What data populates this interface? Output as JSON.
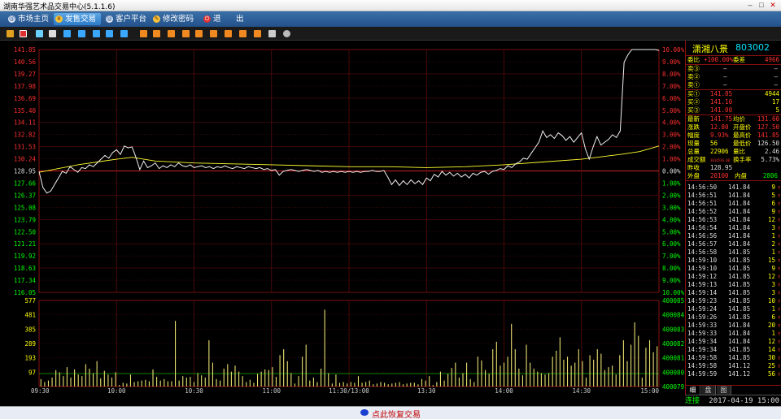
{
  "window": {
    "title": "湖南华强艺术品交易中心(5.1.1.6)",
    "min": "–",
    "max": "□",
    "close": "✕"
  },
  "menu": [
    {
      "label": "市场主页",
      "icon": "globe-icon",
      "active": false
    },
    {
      "label": "发售交易",
      "icon": "yen-icon",
      "active": true
    },
    {
      "label": "客户平台",
      "icon": "globe-icon",
      "active": false
    },
    {
      "label": "修改密码",
      "icon": "pencil-icon",
      "active": false
    },
    {
      "label": "退",
      "icon": "power-icon",
      "active": false
    },
    {
      "label": "出",
      "icon": "",
      "active": false
    }
  ],
  "stock": {
    "name": "潇湘八景",
    "code": "803002"
  },
  "quote": {
    "weibi_label": "委比",
    "weibi": "+100.00%",
    "weicha_label": "委差",
    "weicha": "4966",
    "asks": [
      {
        "label": "卖③",
        "price": "—",
        "vol": "—"
      },
      {
        "label": "卖②",
        "price": "—",
        "vol": "—"
      },
      {
        "label": "卖①",
        "price": "—",
        "vol": "—"
      }
    ],
    "bids": [
      {
        "label": "买①",
        "price": "141.85",
        "vol": "4944"
      },
      {
        "label": "买②",
        "price": "141.10",
        "vol": "17"
      },
      {
        "label": "买③",
        "price": "141.00",
        "vol": "5"
      }
    ],
    "stats": [
      {
        "l1": "最新",
        "v1": "141.75",
        "l2": "均价",
        "v2": "131.60"
      },
      {
        "l1": "涨跌",
        "v1": "12.80",
        "l2": "开盘价",
        "v2": "127.50"
      },
      {
        "l1": "幅度",
        "v1": "9.93%",
        "l2": "最高价",
        "v2": "141.85"
      },
      {
        "l1": "现量",
        "v1": "56",
        "l2": "最低价",
        "v2": "126.50"
      },
      {
        "l1": "总量",
        "v1": "22906",
        "l2": "量比",
        "v2": "2.46"
      },
      {
        "l1": "成交额",
        "v1": "3014536.00",
        "l2": "换手率",
        "v2": "5.73%"
      }
    ],
    "prev_label": "昨收",
    "prev": "128.95",
    "outer_label": "外盘",
    "outer": "20100",
    "inner_label": "内盘",
    "inner": "2806"
  },
  "trades": [
    {
      "time": "14:56:50",
      "price": "141.84",
      "vol": "9"
    },
    {
      "time": "14:56:51",
      "price": "141.84",
      "vol": "5"
    },
    {
      "time": "14:56:51",
      "price": "141.84",
      "vol": "6"
    },
    {
      "time": "14:56:52",
      "price": "141.84",
      "vol": "9"
    },
    {
      "time": "14:56:53",
      "price": "141.84",
      "vol": "12"
    },
    {
      "time": "14:56:54",
      "price": "141.84",
      "vol": "3"
    },
    {
      "time": "14:56:56",
      "price": "141.84",
      "vol": "1"
    },
    {
      "time": "14:56:57",
      "price": "141.84",
      "vol": "2"
    },
    {
      "time": "14:56:58",
      "price": "141.85",
      "vol": "1"
    },
    {
      "time": "14:59:10",
      "price": "141.85",
      "vol": "15"
    },
    {
      "time": "14:59:10",
      "price": "141.85",
      "vol": "9"
    },
    {
      "time": "14:59:12",
      "price": "141.85",
      "vol": "12"
    },
    {
      "time": "14:59:13",
      "price": "141.85",
      "vol": "3"
    },
    {
      "time": "14:59:14",
      "price": "141.85",
      "vol": "3"
    },
    {
      "time": "14:59:23",
      "price": "141.85",
      "vol": "10"
    },
    {
      "time": "14:59:24",
      "price": "141.85",
      "vol": "1"
    },
    {
      "time": "14:59:26",
      "price": "141.85",
      "vol": "6"
    },
    {
      "time": "14:59:33",
      "price": "141.84",
      "vol": "20"
    },
    {
      "time": "14:59:33",
      "price": "141.84",
      "vol": "1"
    },
    {
      "time": "14:59:34",
      "price": "141.84",
      "vol": "12"
    },
    {
      "time": "14:59:34",
      "price": "141.85",
      "vol": "14"
    },
    {
      "time": "14:59:58",
      "price": "141.85",
      "vol": "30"
    },
    {
      "time": "14:59:58",
      "price": "141.12",
      "vol": "25"
    },
    {
      "time": "14:59:59",
      "price": "141.12",
      "vol": "56"
    }
  ],
  "tabs": [
    "细",
    "盘",
    "图"
  ],
  "status": {
    "conn": "连接",
    "datetime": "2017-04-19 15:00"
  },
  "bottom": {
    "resume": "点此恢复交易"
  },
  "chart_data": {
    "type": "line",
    "price_axis": [
      "141.85",
      "140.56",
      "139.27",
      "137.98",
      "136.69",
      "135.40",
      "134.11",
      "132.82",
      "131.53",
      "130.24",
      "128.95",
      "127.66",
      "126.37",
      "125.08",
      "123.79",
      "122.50",
      "121.21",
      "119.92",
      "118.63",
      "117.34",
      "116.05"
    ],
    "pct_axis": [
      "10.00%",
      "9.00%",
      "8.00%",
      "7.00%",
      "6.00%",
      "5.00%",
      "4.00%",
      "3.00%",
      "2.00%",
      "1.00%",
      "0.00%",
      "1.00%",
      "2.00%",
      "3.00%",
      "4.00%",
      "5.00%",
      "6.00%",
      "7.00%",
      "8.00%",
      "9.00%",
      "10.00%"
    ],
    "vol_axis": [
      "577",
      "481",
      "385",
      "289",
      "193",
      "97"
    ],
    "vol_axis_right": [
      "400085",
      "400084",
      "400083",
      "400082",
      "400081",
      "400080",
      "400079"
    ],
    "time_labels": [
      "09:30",
      "10:00",
      "10:30",
      "11:00",
      "11:30/13:00",
      "13:30",
      "14:00",
      "14:30",
      "15:00"
    ],
    "prev_close": 128.95,
    "price_min": 116.05,
    "price_max": 141.85,
    "vol_max": 577,
    "price_series": [
      [
        0,
        128.9
      ],
      [
        1,
        127.2
      ],
      [
        2,
        126.6
      ],
      [
        3,
        126.8
      ],
      [
        4,
        127.5
      ],
      [
        5,
        128.2
      ],
      [
        6,
        128.9
      ],
      [
        7,
        128.7
      ],
      [
        8,
        129.4
      ],
      [
        9,
        129.1
      ],
      [
        10,
        128.8
      ],
      [
        11,
        129.3
      ],
      [
        12,
        129.2
      ],
      [
        13,
        129.6
      ],
      [
        14,
        129.4
      ],
      [
        15,
        129.8
      ],
      [
        16,
        130.2
      ],
      [
        17,
        130.6
      ],
      [
        18,
        130.3
      ],
      [
        19,
        130.9
      ],
      [
        20,
        131.2
      ],
      [
        21,
        130.7
      ],
      [
        22,
        131.6
      ],
      [
        23,
        131.4
      ],
      [
        24,
        131.5
      ],
      [
        25,
        130.4
      ],
      [
        26,
        129.1
      ],
      [
        27,
        130.0
      ],
      [
        28,
        129.3
      ],
      [
        29,
        129.5
      ],
      [
        30,
        129.8
      ],
      [
        31,
        129.2
      ],
      [
        32,
        129.5
      ],
      [
        33,
        129.3
      ],
      [
        34,
        129.6
      ],
      [
        35,
        129.4
      ],
      [
        36,
        129.8
      ],
      [
        37,
        129.5
      ],
      [
        38,
        129.4
      ],
      [
        39,
        129.6
      ],
      [
        40,
        129.3
      ],
      [
        41,
        129.4
      ],
      [
        42,
        129.5
      ],
      [
        43,
        129.3
      ],
      [
        44,
        129.4
      ],
      [
        45,
        129.2
      ],
      [
        46,
        129.4
      ],
      [
        47,
        129.3
      ],
      [
        48,
        129.5
      ],
      [
        49,
        129.3
      ],
      [
        50,
        129.2
      ],
      [
        51,
        129.4
      ],
      [
        52,
        129.3
      ],
      [
        53,
        129.2
      ],
      [
        54,
        129.4
      ],
      [
        55,
        129.3
      ],
      [
        56,
        129.2
      ],
      [
        57,
        129.3
      ],
      [
        58,
        129.1
      ],
      [
        59,
        129.2
      ],
      [
        60,
        129.0
      ],
      [
        61,
        129.1
      ],
      [
        62,
        128.5
      ],
      [
        63,
        128.9
      ],
      [
        64,
        129.0
      ],
      [
        65,
        129.1
      ],
      [
        66,
        129.0
      ],
      [
        67,
        128.9
      ],
      [
        68,
        129.0
      ],
      [
        69,
        129.1
      ],
      [
        70,
        129.0
      ],
      [
        71,
        128.9
      ],
      [
        72,
        129.0
      ],
      [
        73,
        128.8
      ],
      [
        74,
        128.9
      ],
      [
        75,
        128.8
      ],
      [
        76,
        128.9
      ],
      [
        77,
        128.8
      ],
      [
        78,
        128.9
      ],
      [
        79,
        128.8
      ],
      [
        80,
        128.9
      ],
      [
        81,
        128.8
      ],
      [
        82,
        128.9
      ],
      [
        83,
        128.8
      ],
      [
        84,
        128.9
      ],
      [
        85,
        128.9
      ],
      [
        86,
        129.0
      ],
      [
        87,
        128.9
      ],
      [
        88,
        128.9
      ],
      [
        89,
        129.0
      ],
      [
        90,
        128.3
      ],
      [
        91,
        127.5
      ],
      [
        92,
        128.0
      ],
      [
        93,
        127.4
      ],
      [
        94,
        127.9
      ],
      [
        95,
        127.5
      ],
      [
        96,
        128.0
      ],
      [
        97,
        127.6
      ],
      [
        98,
        127.9
      ],
      [
        99,
        127.5
      ],
      [
        100,
        128.2
      ],
      [
        101,
        127.9
      ],
      [
        102,
        128.6
      ],
      [
        103,
        128.3
      ],
      [
        104,
        128.9
      ],
      [
        105,
        128.5
      ],
      [
        106,
        128.8
      ],
      [
        107,
        128.4
      ],
      [
        108,
        128.7
      ],
      [
        109,
        128.3
      ],
      [
        110,
        128.6
      ],
      [
        111,
        128.2
      ],
      [
        112,
        128.7
      ],
      [
        113,
        128.5
      ],
      [
        114,
        128.8
      ],
      [
        115,
        128.9
      ],
      [
        116,
        128.6
      ],
      [
        117,
        128.9
      ],
      [
        118,
        129.0
      ],
      [
        119,
        129.2
      ],
      [
        120,
        129.1
      ],
      [
        121,
        129.5
      ],
      [
        122,
        129.3
      ],
      [
        123,
        129.7
      ],
      [
        124,
        129.9
      ],
      [
        125,
        130.3
      ],
      [
        126,
        130.2
      ],
      [
        127,
        130.8
      ],
      [
        128,
        131.4
      ],
      [
        129,
        132.0
      ],
      [
        130,
        133.2
      ],
      [
        131,
        132.5
      ],
      [
        132,
        132.8
      ],
      [
        133,
        132.4
      ],
      [
        134,
        133.0
      ],
      [
        135,
        132.7
      ],
      [
        136,
        132.2
      ],
      [
        137,
        132.6
      ],
      [
        138,
        132.0
      ],
      [
        139,
        132.5
      ],
      [
        140,
        133.0
      ],
      [
        141,
        131.3
      ],
      [
        142,
        130.2
      ],
      [
        143,
        131.5
      ],
      [
        144,
        132.6
      ],
      [
        145,
        131.7
      ],
      [
        146,
        132.0
      ],
      [
        147,
        132.3
      ],
      [
        148,
        132.8
      ],
      [
        149,
        132.5
      ],
      [
        150,
        133.2
      ],
      [
        151,
        140.5
      ],
      [
        152,
        141.3
      ],
      [
        153,
        141.85
      ],
      [
        154,
        141.85
      ],
      [
        155,
        141.85
      ],
      [
        156,
        141.85
      ],
      [
        157,
        141.85
      ],
      [
        158,
        141.85
      ],
      [
        159,
        141.85
      ],
      [
        160,
        141.75
      ]
    ],
    "avg_series": [
      [
        0,
        128.8
      ],
      [
        10,
        129.6
      ],
      [
        20,
        130.2
      ],
      [
        24,
        130.4
      ],
      [
        30,
        130.0
      ],
      [
        40,
        129.8
      ],
      [
        50,
        129.7
      ],
      [
        60,
        129.6
      ],
      [
        70,
        129.5
      ],
      [
        80,
        129.4
      ],
      [
        90,
        129.4
      ],
      [
        100,
        129.3
      ],
      [
        110,
        129.4
      ],
      [
        120,
        129.6
      ],
      [
        130,
        129.9
      ],
      [
        140,
        130.2
      ],
      [
        150,
        130.7
      ],
      [
        155,
        131.0
      ],
      [
        160,
        131.6
      ]
    ],
    "volumes": [
      50,
      30,
      40,
      60,
      110,
      95,
      70,
      130,
      60,
      115,
      80,
      70,
      150,
      120,
      90,
      170,
      55,
      105,
      80,
      60,
      95,
      10,
      25,
      20,
      80,
      30,
      35,
      40,
      45,
      35,
      115,
      65,
      40,
      50,
      35,
      35,
      440,
      40,
      70,
      60,
      65,
      30,
      90,
      75,
      60,
      310,
      160,
      50,
      40,
      120,
      150,
      100,
      140,
      100,
      70,
      30,
      45,
      25,
      85,
      100,
      115,
      110,
      130,
      65,
      210,
      250,
      170,
      90,
      20,
      70,
      200,
      280,
      40,
      60,
      30,
      120,
      515,
      90,
      20,
      80,
      25,
      30,
      20,
      30,
      25,
      70,
      25,
      30,
      40,
      15,
      20,
      30,
      25,
      15,
      20,
      25,
      30,
      15,
      20,
      25,
      25,
      15,
      50,
      40,
      70,
      10,
      30,
      100,
      40,
      85,
      125,
      160,
      60,
      90,
      160,
      50,
      30,
      200,
      175,
      110,
      85,
      250,
      300,
      140,
      160,
      200,
      420,
      250,
      120,
      75,
      280,
      160,
      120,
      100,
      90,
      80,
      90,
      200,
      240,
      330,
      180,
      200,
      140,
      160,
      250,
      170,
      60,
      210,
      180,
      250,
      220,
      110,
      130,
      140,
      80,
      210,
      310,
      170,
      280,
      430,
      340,
      60,
      260,
      310,
      230,
      270
    ]
  }
}
